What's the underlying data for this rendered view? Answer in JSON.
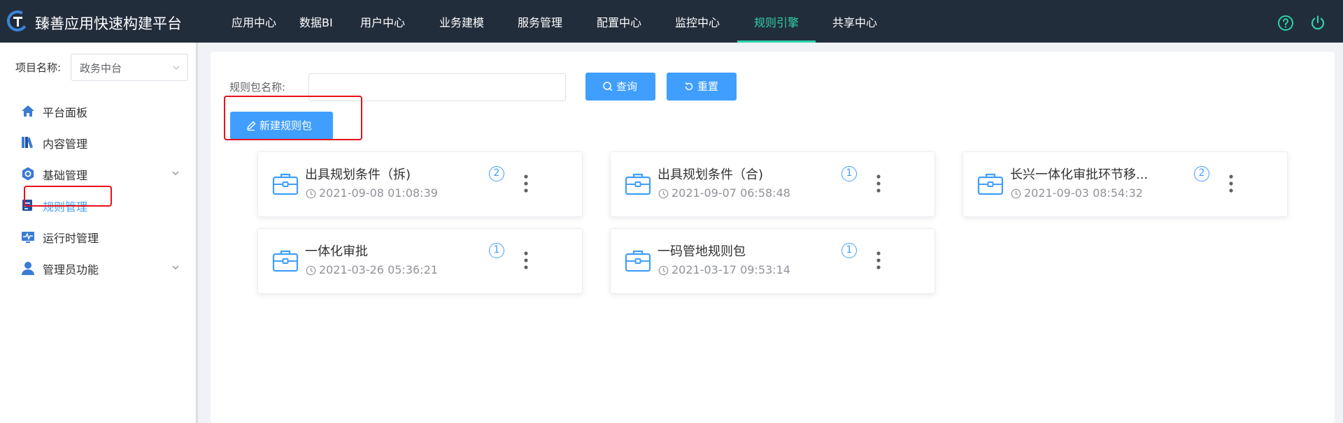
{
  "app": {
    "title": "臻善应用快速构建平台"
  },
  "nav": {
    "items": [
      {
        "label": "应用中心"
      },
      {
        "label": "数据BI"
      },
      {
        "label": "用户中心"
      },
      {
        "label": "业务建模"
      },
      {
        "label": "服务管理"
      },
      {
        "label": "配置中心"
      },
      {
        "label": "监控中心"
      },
      {
        "label": "规则引擎",
        "active": true
      },
      {
        "label": "共享中心"
      }
    ]
  },
  "sidebar": {
    "project_label": "项目名称:",
    "project_value": "政务中台",
    "items": [
      {
        "label": "平台面板",
        "icon": "home-icon"
      },
      {
        "label": "内容管理",
        "icon": "books-icon"
      },
      {
        "label": "基础管理",
        "icon": "gear-icon",
        "expandable": true
      },
      {
        "label": "规则管理",
        "icon": "rules-icon",
        "active": true
      },
      {
        "label": "运行时管理",
        "icon": "monitor-icon"
      },
      {
        "label": "管理员功能",
        "icon": "user-icon",
        "expandable": true
      }
    ]
  },
  "filter": {
    "label": "规则包名称:",
    "value": "",
    "placeholder": "",
    "query_label": "查询",
    "reset_label": "重置",
    "new_label": "新建规则包"
  },
  "cards": [
    {
      "title": "出具规划条件（拆)",
      "time": "2021-09-08 01:08:39",
      "count": "2"
    },
    {
      "title": "出具规划条件（合)",
      "time": "2021-09-07 06:58:48",
      "count": "1"
    },
    {
      "title": "长兴一体化审批环节移...",
      "time": "2021-09-03 08:54:32",
      "count": "2"
    },
    {
      "title": "一体化审批",
      "time": "2021-03-26 05:36:21",
      "count": "1"
    },
    {
      "title": "一码管地规则包",
      "time": "2021-03-17 09:53:14",
      "count": "1"
    }
  ],
  "colors": {
    "topbar": "#222d3c",
    "accent": "#2fd2a8",
    "primary": "#409eff",
    "highlight": "#e8101c"
  }
}
